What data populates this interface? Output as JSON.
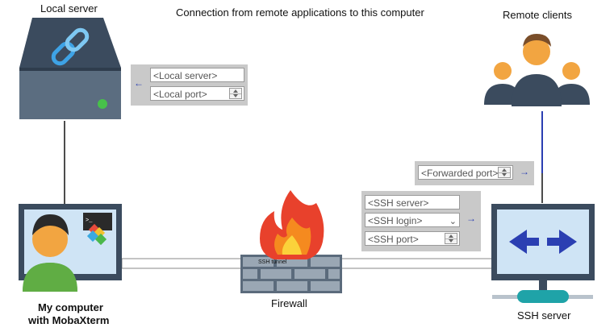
{
  "title": "Connection from remote applications to this computer",
  "labels": {
    "local_server": "Local server",
    "remote_clients": "Remote clients",
    "my_computer_line1": "My computer",
    "my_computer_line2": "with MobaXterm",
    "firewall": "Firewall",
    "ssh_server": "SSH server",
    "ssh_tunnel": "SSH tunnel"
  },
  "local_panel": {
    "local_server_field": "<Local server>",
    "local_port_field": "<Local port>"
  },
  "forward_panel": {
    "forwarded_port_field": "<Forwarded port>"
  },
  "ssh_panel": {
    "ssh_server_field": "<SSH server>",
    "ssh_login_field": "<SSH login>",
    "ssh_port_field": "<SSH port>"
  },
  "colors": {
    "accent_blue": "#2b3fb2",
    "screen_blue": "#cfe4f5",
    "device_dark": "#3b4b5e"
  }
}
